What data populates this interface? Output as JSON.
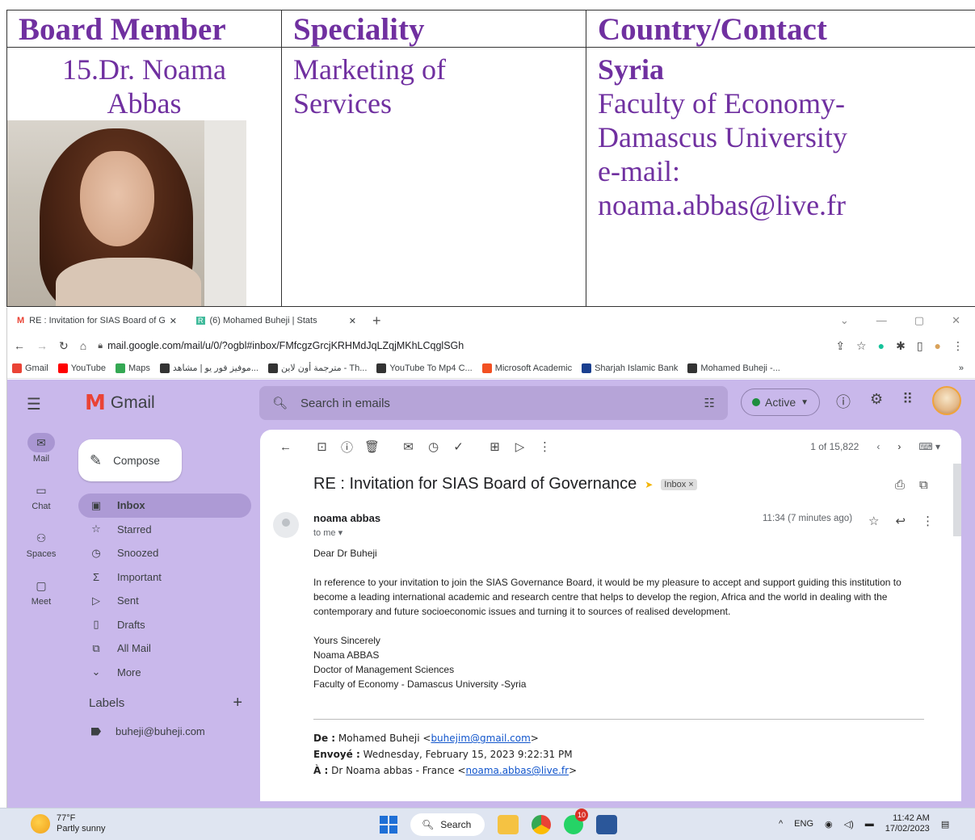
{
  "board": {
    "headers": [
      "Board Member",
      "Speciality",
      "Country/Contact"
    ],
    "member_line1": "15.Dr. Noama",
    "member_line2": "Abbas",
    "speciality_line1": "Marketing of",
    "speciality_line2": "Services",
    "country": "Syria",
    "contact_line1": "Faculty of Economy-",
    "contact_line2": "Damascus University",
    "email_label": "e-mail:",
    "email": "noama.abbas@live.fr"
  },
  "browser": {
    "tabs": [
      {
        "title": "RE : Invitation for SIAS Board of G",
        "close": "✕"
      },
      {
        "title": "(6) Mohamed Buheji | Stats",
        "close": "✕"
      }
    ],
    "new_tab": "+",
    "url": "mail.google.com/mail/u/0/?ogbl#inbox/FMfcgzGrcjKRHMdJqLZqjMKhLCqglSGh",
    "bookmarks": [
      {
        "label": "Gmail",
        "color": "#ea4335"
      },
      {
        "label": "YouTube",
        "color": "#ff0000"
      },
      {
        "label": "Maps",
        "color": "#34a853"
      },
      {
        "label": "موفيز فور يو | مشاهد...",
        "color": "#333333"
      },
      {
        "label": "مترجمة أون لاين - Th...",
        "color": "#333333"
      },
      {
        "label": "YouTube To Mp4 C...",
        "color": "#333333"
      },
      {
        "label": "Microsoft Academic",
        "color": "#f25022"
      },
      {
        "label": "Sharjah Islamic Bank",
        "color": "#1a3f8f"
      },
      {
        "label": "Mohamed Buheji -...",
        "color": "#333333"
      }
    ],
    "bookmarks_more": "»"
  },
  "gmail": {
    "product": "Gmail",
    "search_placeholder": "Search in emails",
    "status": "Active",
    "rail": [
      {
        "label": "Mail",
        "icon": "mail-icon"
      },
      {
        "label": "Chat",
        "icon": "chat-icon"
      },
      {
        "label": "Spaces",
        "icon": "spaces-icon"
      },
      {
        "label": "Meet",
        "icon": "meet-icon"
      }
    ],
    "compose": "Compose",
    "nav": [
      "Inbox",
      "Starred",
      "Snoozed",
      "Important",
      "Sent",
      "Drafts",
      "All Mail",
      "More"
    ],
    "labels_title": "Labels",
    "label_items": [
      "buheji@buheji.com"
    ],
    "pagination": "1 of 15,822",
    "subject": "RE : Invitation for SIAS Board of Governance",
    "inbox_chip": "Inbox ×",
    "sender": "noama abbas",
    "to": "to me ▾",
    "time": "11:34 (7 minutes ago)",
    "greeting": "Dear Dr Buheji",
    "paragraph": "In reference to your invitation to join the SIAS Governance Board, it would be my pleasure to accept and support guiding this institution to become a leading international academic and research centre that helps to develop the region, Africa and the world in dealing with the contemporary and future socioeconomic issues and turning it to sources of realised development.",
    "sign_off": "Yours Sincerely",
    "sig_name": "Noama ABBAS",
    "sig_title": "Doctor of Management Sciences",
    "sig_org": "Faculty of Economy - Damascus University -Syria",
    "fwd_from_label": "De :",
    "fwd_from": "Mohamed Buheji <",
    "fwd_from_email": "buhejim@gmail.com",
    "fwd_from_end": ">",
    "fwd_sent_label": "Envoyé :",
    "fwd_sent": "Wednesday, February 15, 2023 9:22:31 PM",
    "fwd_to_label": "À :",
    "fwd_to": "Dr Noama abbas - France <",
    "fwd_to_email": "noama.abbas@live.fr",
    "fwd_to_end": ">"
  },
  "taskbar": {
    "temp": "77°F",
    "weather": "Partly sunny",
    "search": "Search",
    "badge": "10",
    "lang": "ENG",
    "time": "11:42 AM",
    "date": "17/02/2023"
  }
}
